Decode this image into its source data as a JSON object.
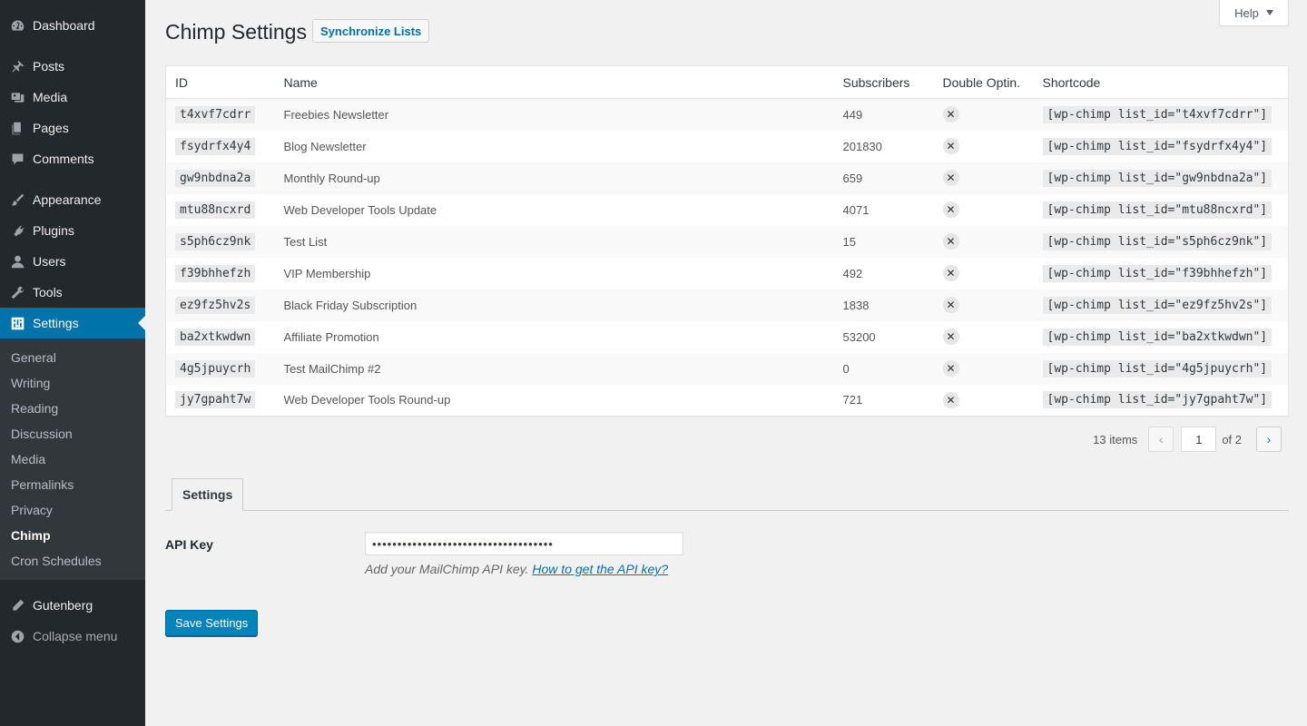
{
  "sidebar": {
    "top_items": [
      {
        "label": "Dashboard",
        "icon": "dashboard-icon"
      }
    ],
    "main_items": [
      {
        "label": "Posts",
        "icon": "pin-icon"
      },
      {
        "label": "Media",
        "icon": "media-icon"
      },
      {
        "label": "Pages",
        "icon": "pages-icon"
      },
      {
        "label": "Comments",
        "icon": "comments-icon"
      }
    ],
    "admin_items": [
      {
        "label": "Appearance",
        "icon": "brush-icon"
      },
      {
        "label": "Plugins",
        "icon": "plug-icon"
      },
      {
        "label": "Users",
        "icon": "user-icon"
      },
      {
        "label": "Tools",
        "icon": "wrench-icon"
      },
      {
        "label": "Settings",
        "icon": "settings-icon"
      }
    ],
    "submenu": [
      "General",
      "Writing",
      "Reading",
      "Discussion",
      "Media",
      "Permalinks",
      "Privacy",
      "Chimp",
      "Cron Schedules"
    ],
    "submenu_current": "Chimp",
    "bottom_items": [
      {
        "label": "Gutenberg",
        "icon": "pencil-icon"
      },
      {
        "label": "Collapse menu",
        "icon": "collapse-icon"
      }
    ]
  },
  "help": {
    "label": "Help"
  },
  "header": {
    "title": "Chimp Settings",
    "sync_button": "Synchronize Lists"
  },
  "table": {
    "columns": [
      "ID",
      "Name",
      "Subscribers",
      "Double Optin.",
      "Shortcode"
    ],
    "rows": [
      {
        "id": "t4xvf7cdrr",
        "name": "Freebies Newsletter",
        "subscribers": "449",
        "double_optin": "✕",
        "shortcode": "[wp-chimp list_id=\"t4xvf7cdrr\"]"
      },
      {
        "id": "fsydrfx4y4",
        "name": "Blog Newsletter",
        "subscribers": "201830",
        "double_optin": "✕",
        "shortcode": "[wp-chimp list_id=\"fsydrfx4y4\"]"
      },
      {
        "id": "gw9nbdna2a",
        "name": "Monthly Round-up",
        "subscribers": "659",
        "double_optin": "✕",
        "shortcode": "[wp-chimp list_id=\"gw9nbdna2a\"]"
      },
      {
        "id": "mtu88ncxrd",
        "name": "Web Developer Tools Update",
        "subscribers": "4071",
        "double_optin": "✕",
        "shortcode": "[wp-chimp list_id=\"mtu88ncxrd\"]"
      },
      {
        "id": "s5ph6cz9nk",
        "name": "Test List",
        "subscribers": "15",
        "double_optin": "✕",
        "shortcode": "[wp-chimp list_id=\"s5ph6cz9nk\"]"
      },
      {
        "id": "f39bhhefzh",
        "name": "VIP Membership",
        "subscribers": "492",
        "double_optin": "✕",
        "shortcode": "[wp-chimp list_id=\"f39bhhefzh\"]"
      },
      {
        "id": "ez9fz5hv2s",
        "name": "Black Friday Subscription",
        "subscribers": "1838",
        "double_optin": "✕",
        "shortcode": "[wp-chimp list_id=\"ez9fz5hv2s\"]"
      },
      {
        "id": "ba2xtkwdwn",
        "name": "Affiliate Promotion",
        "subscribers": "53200",
        "double_optin": "✕",
        "shortcode": "[wp-chimp list_id=\"ba2xtkwdwn\"]"
      },
      {
        "id": "4g5jpuycrh",
        "name": "Test MailChimp #2",
        "subscribers": "0",
        "double_optin": "✕",
        "shortcode": "[wp-chimp list_id=\"4g5jpuycrh\"]"
      },
      {
        "id": "jy7gpaht7w",
        "name": "Web Developer Tools Round-up",
        "subscribers": "721",
        "double_optin": "✕",
        "shortcode": "[wp-chimp list_id=\"jy7gpaht7w\"]"
      }
    ]
  },
  "pagination": {
    "items": "13 items",
    "prev": "‹",
    "current_page": "1",
    "of_text": "of 2",
    "next": "›"
  },
  "settings": {
    "tab_label": "Settings",
    "api_label": "API Key",
    "api_value": "••••••••••••••••••••••••••••••••••••",
    "api_desc": "Add your MailChimp API key.",
    "api_link": "How to get the API key?",
    "save_button": "Save Settings"
  },
  "colors": {
    "sidebar_bg": "#23282d",
    "active_bg": "#0073aa",
    "primary_button": "#0085ba",
    "page_bg": "#f1f1f1"
  }
}
